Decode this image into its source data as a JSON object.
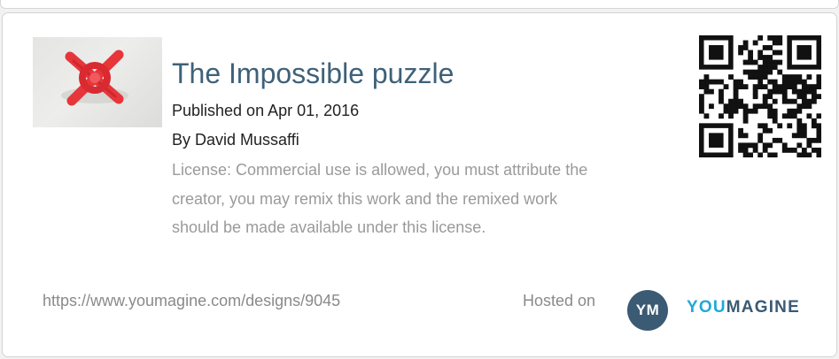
{
  "design": {
    "title": "The Impossible puzzle",
    "published": "Published on Apr 01, 2016",
    "author": "By David Mussaffi",
    "license": "License: Commercial use is allowed, you must attribute the creator, you may remix this work and the remixed work should be made available under this license.",
    "url": "https://www.youmagine.com/designs/9045"
  },
  "footer": {
    "hosted_label": "Hosted on",
    "logo_initials": "YM",
    "brand_part1": "YOU",
    "brand_part2": "MAGINE"
  },
  "colors": {
    "title": "#3f6178",
    "brand_dark": "#3b5a74",
    "brand_light": "#20a9d6",
    "puzzle_red": "#e6363a"
  },
  "icons": {
    "thumbnail": "red-cross-puzzle-photo",
    "qr": "qr-code"
  }
}
